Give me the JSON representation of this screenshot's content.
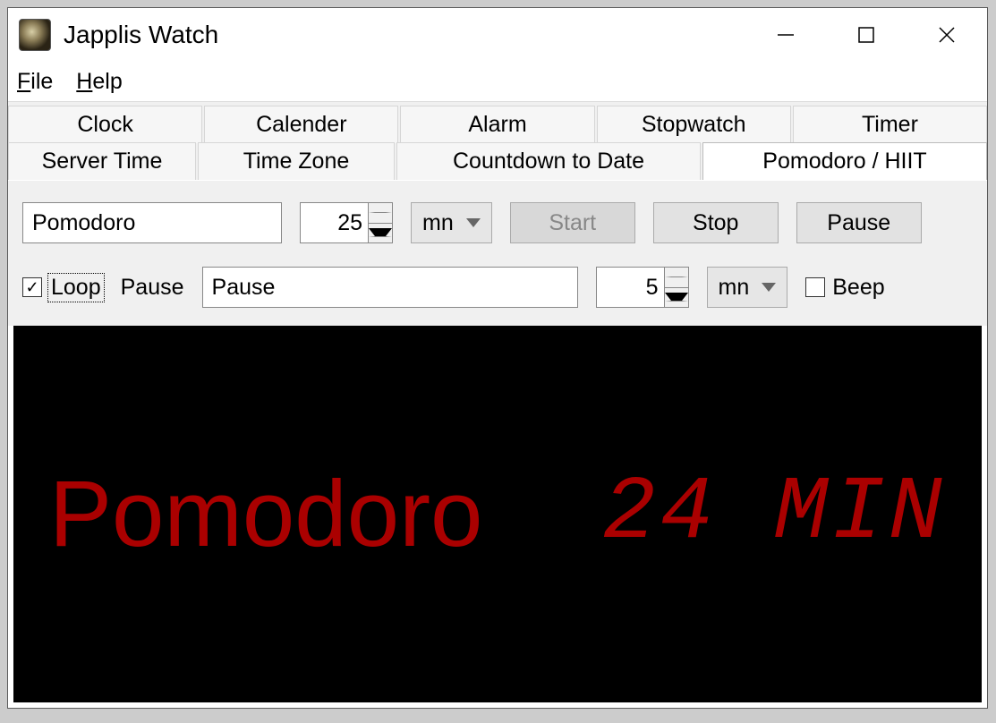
{
  "window": {
    "title": "Japplis Watch"
  },
  "menu": {
    "file": "File",
    "help": "Help"
  },
  "tabs_top": [
    "Clock",
    "Calender",
    "Alarm",
    "Stopwatch",
    "Timer"
  ],
  "tabs_bottom": [
    "Server Time",
    "Time Zone",
    "Countdown to Date",
    "Pomodoro / HIIT"
  ],
  "active_tab": "Pomodoro / HIIT",
  "row1": {
    "name_value": "Pomodoro",
    "duration": "25",
    "unit": "mn",
    "start_label": "Start",
    "stop_label": "Stop",
    "pause_label": "Pause"
  },
  "row2": {
    "loop_checked": true,
    "loop_label": "Loop",
    "pause_label": "Pause",
    "pause_value": "Pause",
    "pause_duration": "5",
    "unit": "mn",
    "beep_checked": false,
    "beep_label": "Beep"
  },
  "display": {
    "name": "Pomodoro",
    "time": "24 min"
  }
}
